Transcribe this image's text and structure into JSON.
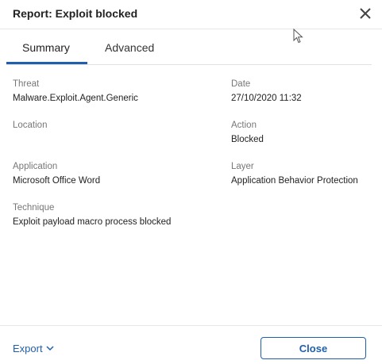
{
  "dialog": {
    "title": "Report: Exploit blocked"
  },
  "tabs": [
    {
      "label": "Summary",
      "active": true
    },
    {
      "label": "Advanced",
      "active": false
    }
  ],
  "fields": {
    "threat": {
      "label": "Threat",
      "value": "Malware.Exploit.Agent.Generic"
    },
    "date": {
      "label": "Date",
      "value": "27/10/2020 11:32"
    },
    "location": {
      "label": "Location",
      "value": ""
    },
    "action": {
      "label": "Action",
      "value": "Blocked"
    },
    "application": {
      "label": "Application",
      "value": "Microsoft Office Word"
    },
    "layer": {
      "label": "Layer",
      "value": "Application Behavior Protection"
    },
    "technique": {
      "label": "Technique",
      "value": "Exploit payload macro process blocked"
    }
  },
  "footer": {
    "export_label": "Export",
    "close_label": "Close"
  },
  "colors": {
    "accent": "#1f5fae"
  },
  "icons": {
    "close": "close-icon",
    "export_dropdown": "chevron-down-icon"
  }
}
